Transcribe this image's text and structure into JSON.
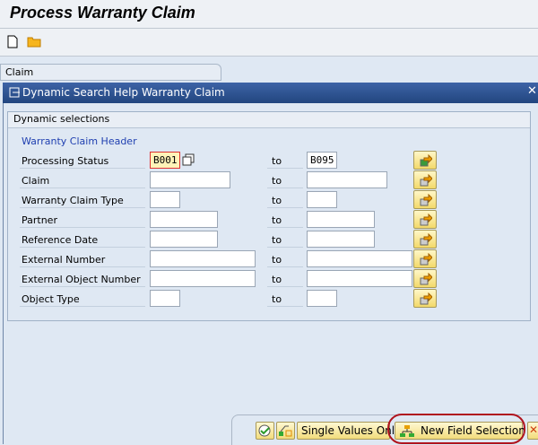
{
  "window": {
    "title": "Process Warranty Claim"
  },
  "toolbar": {
    "icons": [
      "new-document-icon",
      "open-folder-icon"
    ]
  },
  "tab": {
    "label": "Claim"
  },
  "dialog": {
    "title": "Dynamic Search Help Warranty Claim",
    "group_title": "Dynamic selections",
    "section": "Warranty Claim Header",
    "to_label": "to",
    "rows": [
      {
        "label": "Processing Status",
        "from": "B001",
        "to": "B095"
      },
      {
        "label": "Claim",
        "from": "",
        "to": ""
      },
      {
        "label": "Warranty Claim Type",
        "from": "",
        "to": ""
      },
      {
        "label": "Partner",
        "from": "",
        "to": ""
      },
      {
        "label": "Reference Date",
        "from": "",
        "to": ""
      },
      {
        "label": "External Number",
        "from": "",
        "to": ""
      },
      {
        "label": "External Object Number",
        "from": "",
        "to": ""
      },
      {
        "label": "Object Type",
        "from": "",
        "to": ""
      }
    ],
    "buttons": {
      "single_values": "Single Values Only",
      "new_field_selection": "New Field Selection"
    },
    "colors": {
      "header": "#2a4f8f",
      "highlight": "#c0141e"
    }
  }
}
